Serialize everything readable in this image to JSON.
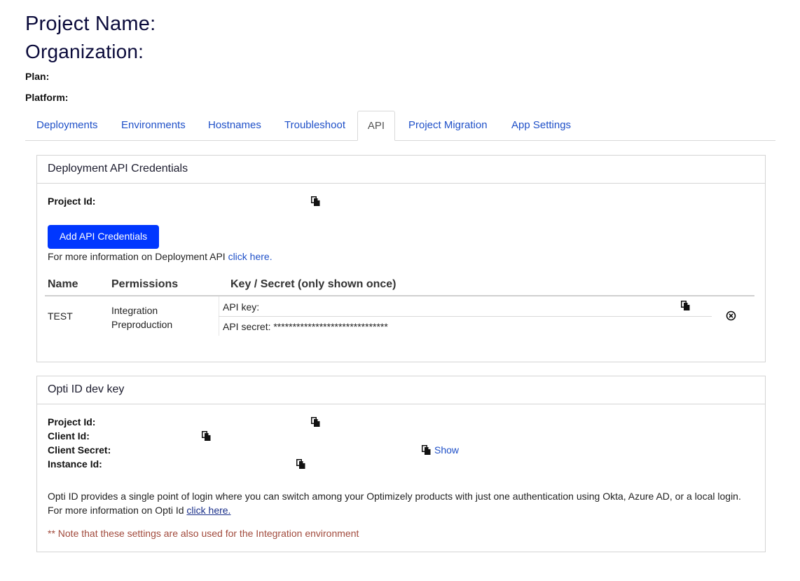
{
  "header": {
    "project_name_label": "Project Name:",
    "organization_label": "Organization:",
    "plan_label": "Plan:",
    "platform_label": "Platform:"
  },
  "tabs": [
    {
      "label": "Deployments"
    },
    {
      "label": "Environments"
    },
    {
      "label": "Hostnames"
    },
    {
      "label": "Troubleshoot"
    },
    {
      "label": "API",
      "active": true
    },
    {
      "label": "Project Migration"
    },
    {
      "label": "App Settings"
    }
  ],
  "deployment_api": {
    "title": "Deployment API Credentials",
    "project_id_label": "Project Id:",
    "add_button": "Add API Credentials",
    "info_text": "For more information on Deployment API ",
    "info_link": "click here.",
    "table": {
      "headers": [
        "Name",
        "Permissions",
        "Key / Secret (only shown once)"
      ],
      "rows": [
        {
          "name": "TEST",
          "permissions": [
            "Integration",
            "Preproduction"
          ],
          "api_key_label": "API key:",
          "api_secret_label": "API secret: ",
          "api_secret_value": "******************************"
        }
      ]
    }
  },
  "opti_id": {
    "title": "Opti ID dev key",
    "project_id_label": "Project Id:",
    "client_id_label": "Client Id:",
    "client_secret_label": "Client Secret:",
    "show_label": "Show",
    "instance_id_label": "Instance Id:",
    "description": "Opti ID provides a single point of login where you can switch among your Optimizely products with just one authentication using Okta, Azure AD, or a local login. For more information on Opti Id ",
    "description_link": "click here.",
    "note": "** Note that these settings are also used for the Integration environment"
  },
  "colors": {
    "primary_button": "#0037ff",
    "link": "#1f50c8",
    "note": "#a14a3c",
    "heading": "#0b0b3b"
  }
}
